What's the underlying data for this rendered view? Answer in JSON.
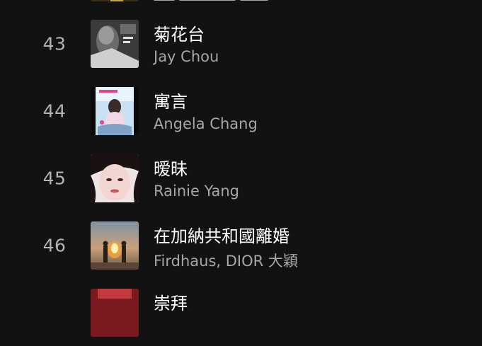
{
  "tracks": [
    {
      "number": "43",
      "title": "菊花台",
      "artist": "Jay Chou"
    },
    {
      "number": "44",
      "title": "寓言",
      "artist": "Angela Chang"
    },
    {
      "number": "45",
      "title": "暧昧",
      "artist": "Rainie Yang"
    },
    {
      "number": "46",
      "title": "在加納共和國離婚",
      "artist": "Firdhaus, DIOR 大穎"
    }
  ],
  "next_track_partial": {
    "title": "崇拜"
  }
}
